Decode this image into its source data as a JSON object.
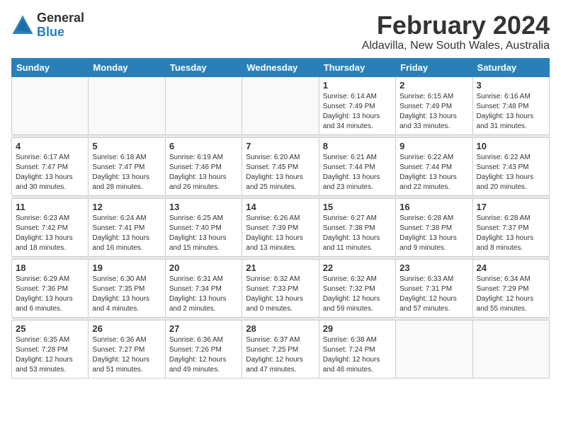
{
  "app": {
    "name": "GeneralBlue",
    "logo_text_general": "General",
    "logo_text_blue": "Blue"
  },
  "header": {
    "month_year": "February 2024",
    "location": "Aldavilla, New South Wales, Australia"
  },
  "weekdays": [
    "Sunday",
    "Monday",
    "Tuesday",
    "Wednesday",
    "Thursday",
    "Friday",
    "Saturday"
  ],
  "weeks": [
    [
      {
        "day": "",
        "info": ""
      },
      {
        "day": "",
        "info": ""
      },
      {
        "day": "",
        "info": ""
      },
      {
        "day": "",
        "info": ""
      },
      {
        "day": "1",
        "info": "Sunrise: 6:14 AM\nSunset: 7:49 PM\nDaylight: 13 hours\nand 34 minutes."
      },
      {
        "day": "2",
        "info": "Sunrise: 6:15 AM\nSunset: 7:49 PM\nDaylight: 13 hours\nand 33 minutes."
      },
      {
        "day": "3",
        "info": "Sunrise: 6:16 AM\nSunset: 7:48 PM\nDaylight: 13 hours\nand 31 minutes."
      }
    ],
    [
      {
        "day": "4",
        "info": "Sunrise: 6:17 AM\nSunset: 7:47 PM\nDaylight: 13 hours\nand 30 minutes."
      },
      {
        "day": "5",
        "info": "Sunrise: 6:18 AM\nSunset: 7:47 PM\nDaylight: 13 hours\nand 28 minutes."
      },
      {
        "day": "6",
        "info": "Sunrise: 6:19 AM\nSunset: 7:46 PM\nDaylight: 13 hours\nand 26 minutes."
      },
      {
        "day": "7",
        "info": "Sunrise: 6:20 AM\nSunset: 7:45 PM\nDaylight: 13 hours\nand 25 minutes."
      },
      {
        "day": "8",
        "info": "Sunrise: 6:21 AM\nSunset: 7:44 PM\nDaylight: 13 hours\nand 23 minutes."
      },
      {
        "day": "9",
        "info": "Sunrise: 6:22 AM\nSunset: 7:44 PM\nDaylight: 13 hours\nand 22 minutes."
      },
      {
        "day": "10",
        "info": "Sunrise: 6:22 AM\nSunset: 7:43 PM\nDaylight: 13 hours\nand 20 minutes."
      }
    ],
    [
      {
        "day": "11",
        "info": "Sunrise: 6:23 AM\nSunset: 7:42 PM\nDaylight: 13 hours\nand 18 minutes."
      },
      {
        "day": "12",
        "info": "Sunrise: 6:24 AM\nSunset: 7:41 PM\nDaylight: 13 hours\nand 16 minutes."
      },
      {
        "day": "13",
        "info": "Sunrise: 6:25 AM\nSunset: 7:40 PM\nDaylight: 13 hours\nand 15 minutes."
      },
      {
        "day": "14",
        "info": "Sunrise: 6:26 AM\nSunset: 7:39 PM\nDaylight: 13 hours\nand 13 minutes."
      },
      {
        "day": "15",
        "info": "Sunrise: 6:27 AM\nSunset: 7:38 PM\nDaylight: 13 hours\nand 11 minutes."
      },
      {
        "day": "16",
        "info": "Sunrise: 6:28 AM\nSunset: 7:38 PM\nDaylight: 13 hours\nand 9 minutes."
      },
      {
        "day": "17",
        "info": "Sunrise: 6:28 AM\nSunset: 7:37 PM\nDaylight: 13 hours\nand 8 minutes."
      }
    ],
    [
      {
        "day": "18",
        "info": "Sunrise: 6:29 AM\nSunset: 7:36 PM\nDaylight: 13 hours\nand 6 minutes."
      },
      {
        "day": "19",
        "info": "Sunrise: 6:30 AM\nSunset: 7:35 PM\nDaylight: 13 hours\nand 4 minutes."
      },
      {
        "day": "20",
        "info": "Sunrise: 6:31 AM\nSunset: 7:34 PM\nDaylight: 13 hours\nand 2 minutes."
      },
      {
        "day": "21",
        "info": "Sunrise: 6:32 AM\nSunset: 7:33 PM\nDaylight: 13 hours\nand 0 minutes."
      },
      {
        "day": "22",
        "info": "Sunrise: 6:32 AM\nSunset: 7:32 PM\nDaylight: 12 hours\nand 59 minutes."
      },
      {
        "day": "23",
        "info": "Sunrise: 6:33 AM\nSunset: 7:31 PM\nDaylight: 12 hours\nand 57 minutes."
      },
      {
        "day": "24",
        "info": "Sunrise: 6:34 AM\nSunset: 7:29 PM\nDaylight: 12 hours\nand 55 minutes."
      }
    ],
    [
      {
        "day": "25",
        "info": "Sunrise: 6:35 AM\nSunset: 7:28 PM\nDaylight: 12 hours\nand 53 minutes."
      },
      {
        "day": "26",
        "info": "Sunrise: 6:36 AM\nSunset: 7:27 PM\nDaylight: 12 hours\nand 51 minutes."
      },
      {
        "day": "27",
        "info": "Sunrise: 6:36 AM\nSunset: 7:26 PM\nDaylight: 12 hours\nand 49 minutes."
      },
      {
        "day": "28",
        "info": "Sunrise: 6:37 AM\nSunset: 7:25 PM\nDaylight: 12 hours\nand 47 minutes."
      },
      {
        "day": "29",
        "info": "Sunrise: 6:38 AM\nSunset: 7:24 PM\nDaylight: 12 hours\nand 46 minutes."
      },
      {
        "day": "",
        "info": ""
      },
      {
        "day": "",
        "info": ""
      }
    ]
  ]
}
